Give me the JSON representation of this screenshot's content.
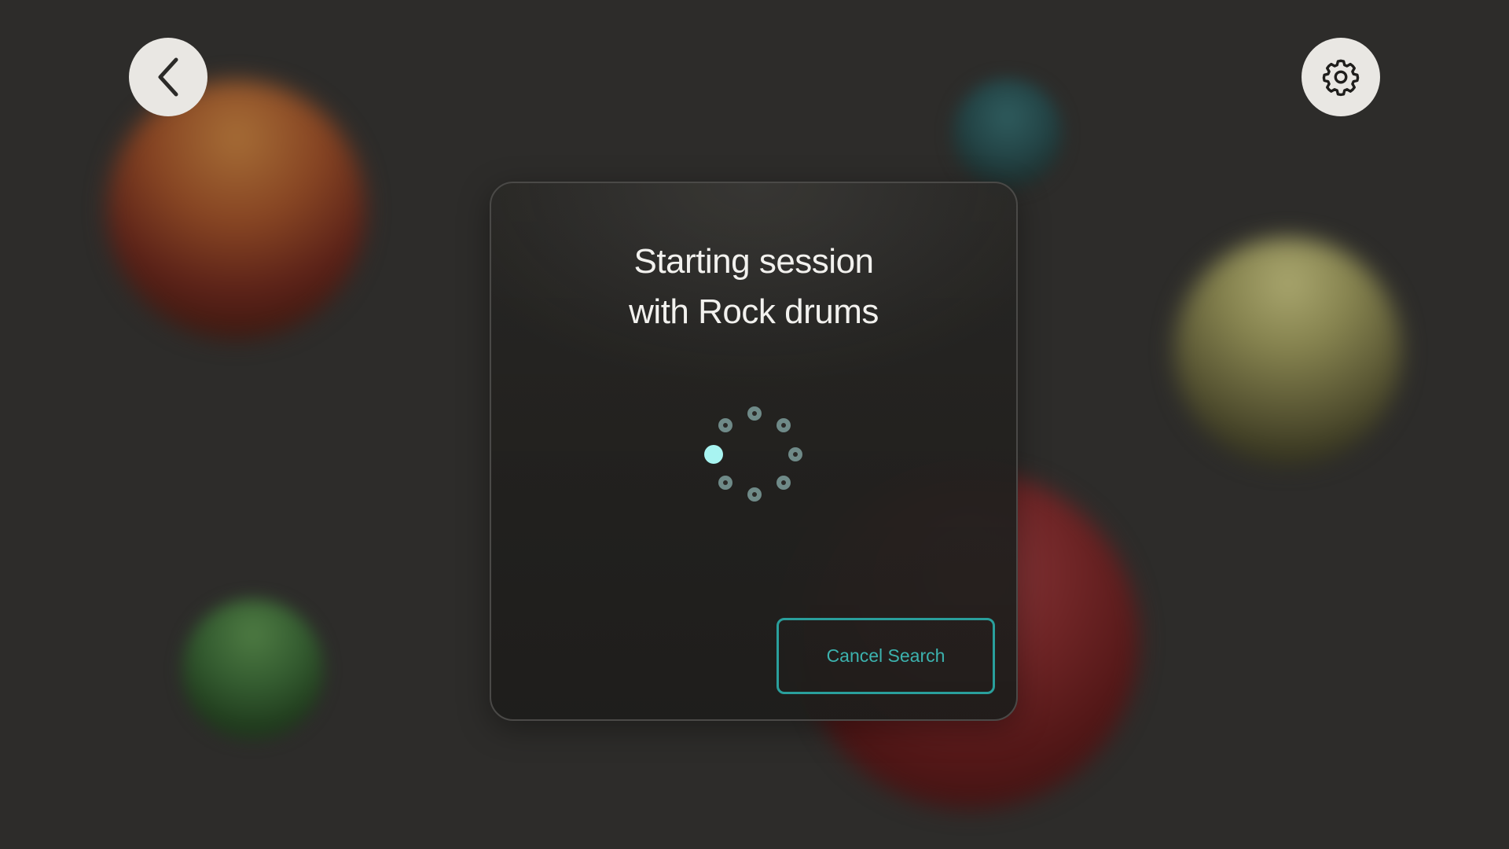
{
  "dialog": {
    "title_line1": "Starting session",
    "title_line2": "with Rock drums",
    "cancel_label": "Cancel Search"
  },
  "icons": {
    "back": "chevron-left-icon",
    "settings": "gear-icon",
    "loading": "spinner-icon"
  },
  "colors": {
    "background": "#2d2c2a",
    "accent": "#2a9f9c",
    "spinner_active": "#a8f4f1",
    "spinner_inactive": "#6f8a88",
    "button_surface": "#e9e7e3"
  }
}
